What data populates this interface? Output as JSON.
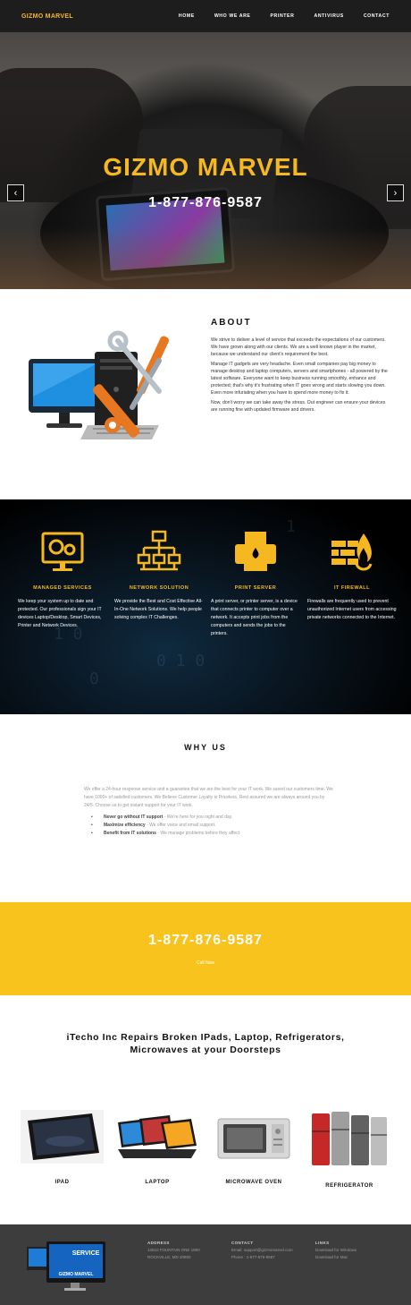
{
  "brand": "GIZMO MARVEL",
  "colors": {
    "accent": "#f5b820",
    "nav_bg": "#1d1d1d",
    "cta_bg": "#f8c31d",
    "footer_bg": "#3d3d3d"
  },
  "nav": {
    "items": [
      "HOME",
      "WHO WE ARE",
      "PRINTER",
      "ANTIVIRUS",
      "CONTACT"
    ]
  },
  "hero": {
    "title": "GIZMO MARVEL",
    "phone": "1-877-876-9587",
    "slides": 4,
    "active_slide": 1,
    "prev_icon": "chevron-left-icon",
    "next_icon": "chevron-right-icon"
  },
  "about": {
    "title": "ABOUT",
    "paragraphs": [
      "We strive to deliver a level of service that exceeds the expectations of our customers. We have grown along with our clients. We are a well known player in the market, because we understand our client's requirement the best.",
      "Manage IT gadgets are very headache. Even small companies pay big money to manage desktop and laptop computers, servers and smartphones - all powered by the latest software. Everyone want to keep business running smoothly, enhance and protected; that's why it's frustrating when IT goes wrong and starts slowing you down. Even more infuriating when you have to spend more money to fix it.",
      "Now, don't worry we can take away the stress. Out engineer can ensure your devices are running fine with updated firmware and drivers."
    ]
  },
  "services": [
    {
      "icon": "gears-monitor-icon",
      "title": "MANAGED SERVICES",
      "text": "We keep your system up to date and protected. Our professionals sign your IT devices Laptop/Desktop, Smart Devices, Printer and Network Devices."
    },
    {
      "icon": "network-icon",
      "title": "NETWORK SOLUTION",
      "text": "We provide the Best and Cost Effective All-In-One Network Solutions. We help people solving complex IT Challenges."
    },
    {
      "icon": "printer-icon",
      "title": "PRINT SERVER",
      "text": "A print server, or printer server, is a device that connects printer to computer over a network. It accepts print jobs from the computers and sends the jobs to the printers."
    },
    {
      "icon": "firewall-icon",
      "title": "IT FIREWALL",
      "text": "Firewalls are frequently used to prevent unauthorized Internet users from accessing private networks connected to the Internet."
    }
  ],
  "why": {
    "title": "WHY US",
    "intro": "We offer a 24-hour response service and a guarantee that we are the best for your IT work. We saved our customers time. We have 1000+ of satisfied customers. We Believe Customer Loyalty is Priceless. Rest assured we are always around you by 24/5. Choose us to get instant support for your IT work.",
    "bullets": [
      {
        "bold": "Never go without IT support",
        "rest": " - We're here for you night and day."
      },
      {
        "bold": "Maximize efficiency",
        "rest": " - We offer voice and email support."
      },
      {
        "bold": "Benefit from IT solutions",
        "rest": " - We manage problems before they affect."
      }
    ]
  },
  "cta": {
    "phone": "1-877-876-9587",
    "link": "Call Now"
  },
  "repairs": {
    "title": "iTecho Inc Repairs Broken IPads, Laptop, Refrigerators, Microwaves at your Doorsteps",
    "products": [
      "IPAD",
      "LAPTOP",
      "MICROWAVE OVEN",
      "REFRIGERATOR"
    ]
  },
  "footer": {
    "logo_text": "SERVICE",
    "logo_brand": "GIZMO MARVEL",
    "address": {
      "h": "ADDRESS",
      "l1": "13810 FOUNTAIN ONE 1890",
      "l2": "ROCKVILLE, MD 20850"
    },
    "contact": {
      "h": "CONTACT",
      "l1": "Email: support@gizmomarvel.com",
      "l2": "Phone : 1-877-876-9587"
    },
    "links": {
      "h": "LINKS",
      "l1": "Download for Windows",
      "l2": "Download for Mac"
    }
  }
}
